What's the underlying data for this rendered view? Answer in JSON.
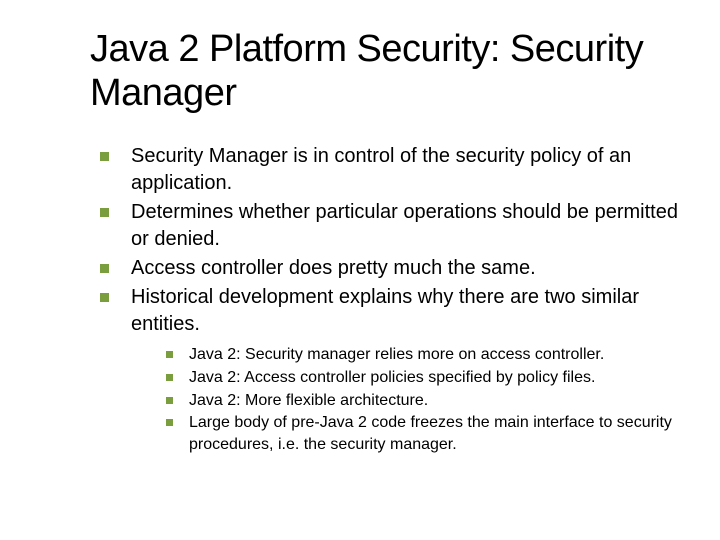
{
  "title": "Java 2 Platform Security: Security Manager",
  "main": [
    "Security Manager is in control of the security policy of an application.",
    "Determines whether particular operations should be permitted or denied.",
    "Access controller does pretty much the same.",
    "Historical development explains why there are two similar entities."
  ],
  "sub": [
    "Java 2: Security manager relies more on access controller.",
    "Java 2: Access controller policies specified by policy files.",
    "Java 2: More flexible architecture.",
    "Large body of pre-Java 2 code freezes the main interface to security procedures, i.e. the security manager."
  ]
}
